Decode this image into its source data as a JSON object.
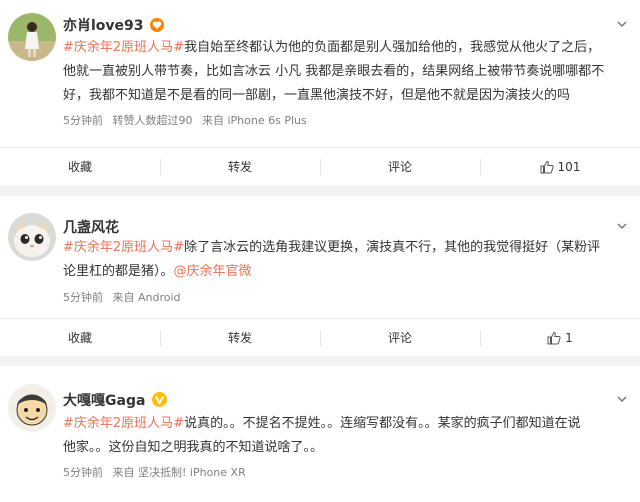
{
  "posts": [
    {
      "user": "亦肖love93",
      "badge": "heart-badge-icon",
      "tag": "#庆余年2原班人马#",
      "text": "我自始至终都认为他的负面都是别人强加给他的，我感觉从他火了之后，",
      "text_line2": "他就一直被别人带节奏，比如言冰云 小凡 我都是亲眼去看的，结果网络上被带节奏说哪哪都不",
      "text_line3": "好，我都不知道是不是看的同一部剧，一直黑他演技不好，但是他不就是因为演技火的吗",
      "time": "5分钟前",
      "extra": "转赞人数超过90",
      "source": "来自 iPhone 6s Plus",
      "actions": {
        "favorite": "收藏",
        "repost": "转发",
        "comment": "评论",
        "likes": "101"
      }
    },
    {
      "user": "几盏风花",
      "tag": "#庆余年2原班人马#",
      "text": "除了言冰云的选角我建议更换，演技真不行，其他的我觉得挺好（某粉评",
      "text_line2": "论里杠的都是猪）。",
      "mention": "@庆余年官微",
      "time": "5分钟前",
      "source": "来自 Android",
      "actions": {
        "favorite": "收藏",
        "repost": "转发",
        "comment": "评论",
        "likes": "1"
      }
    },
    {
      "user": "大嘎嘎Gaga",
      "badge": "verified-v-icon",
      "tag": "#庆余年2原班人马#",
      "text": "说真的。。不提名不提姓。。连缩写都没有。。某家的疯子们都知道在说",
      "text_line2": "他家。。这份自知之明我真的不知道说啥了。。",
      "time": "5分钟前",
      "source": "来自 坚决抵制! iPhone XR"
    }
  ],
  "colors": {
    "tag": "#eb7350",
    "meta": "#808080",
    "background": "#f2f2f2"
  }
}
